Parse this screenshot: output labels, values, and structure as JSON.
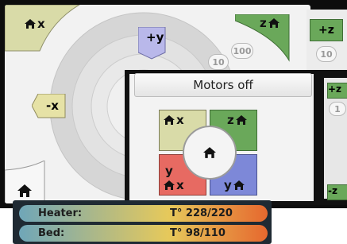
{
  "colors": {
    "x_home": "#d9dba8",
    "y_axis": "#b9b8ea",
    "z_axis": "#6aa85a",
    "x_neg": "#e6e2a6",
    "y_red": "#e76a62",
    "y_blue": "#7d88d8"
  },
  "jog": {
    "home_x": "x",
    "plus_y": "+y",
    "home_z": "z",
    "minus_x": "-x",
    "step_100": "100",
    "step_10": "10"
  },
  "right_partial": {
    "plus_z": "+z",
    "step_10": "10",
    "minus_z": "-z"
  },
  "front": {
    "motors_off": "Motors off",
    "home_x": "x",
    "home_z": "z",
    "home_y_letter": "y",
    "home_x2": "x",
    "home_y": "y",
    "right_plus_z": "+z",
    "right_step": "1",
    "right_minus_z": "-z"
  },
  "status": {
    "heater_label": "Heater:",
    "heater_value": "T° 228/220",
    "bed_label": "Bed:",
    "bed_value": "T° 98/110"
  }
}
